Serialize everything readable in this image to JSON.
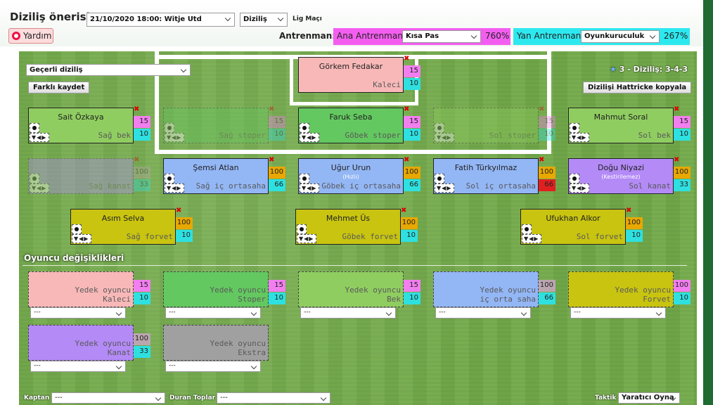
{
  "title": "Diziliş önerisi",
  "match_select": "21/10/2020 18:00: Witje Utd",
  "view_select": "Diziliş",
  "match_type": "Lig Maçı",
  "help_label": "Yardım",
  "training": {
    "label": "Antrenman:",
    "main_label": "Ana Antrenman",
    "main_value": "Kısa Pas",
    "main_pct": "760%",
    "side_label": "Yan Antrenman",
    "side_value": "Oyunkuruculuk",
    "side_pct": "267%"
  },
  "lineup_select": "Geçerli diziliş",
  "save_as_label": "Farklı kaydet",
  "copy_label": "Dizilişi Hattricke kopyala",
  "formation_label": "3 - Diziliş: 3-4-3",
  "players": {
    "gk": {
      "name": "Görkem Fedakar",
      "pos": "Kaleci",
      "s1": "15",
      "s2": "10"
    },
    "rb": {
      "name": "Sait Özkaya",
      "pos": "Sağ bek",
      "s1": "15",
      "s2": "10"
    },
    "rcd": {
      "name": "",
      "pos": "Sağ stoper",
      "s1": "15",
      "s2": "10"
    },
    "cd": {
      "name": "Faruk Seba",
      "pos": "Göbek stoper",
      "s1": "15",
      "s2": "10"
    },
    "lcd": {
      "name": "",
      "pos": "Sol stoper",
      "s1": "15",
      "s2": "10"
    },
    "lb": {
      "name": "Mahmut Soral",
      "pos": "Sol bek",
      "s1": "15",
      "s2": "10"
    },
    "rw": {
      "name": "",
      "pos": "Sağ kanat",
      "s1": "100",
      "s2": "33"
    },
    "rim": {
      "name": "Şemsi Atlan",
      "pos": "Sağ iç ortasaha",
      "s1": "100",
      "s2": "66"
    },
    "cim": {
      "name": "Uğur Urun",
      "sub": "(Hızlı)",
      "pos": "Göbek iç ortasaha",
      "s1": "100",
      "s2": "66"
    },
    "lim": {
      "name": "Fatih Türkyılmaz",
      "pos": "Sol iç ortasaha",
      "s1": "100",
      "s2": "66"
    },
    "lw": {
      "name": "Doğu Niyazi",
      "sub": "(Kestirilemez)",
      "pos": "Sol kanat",
      "s1": "100",
      "s2": "33"
    },
    "rf": {
      "name": "Asım Selva",
      "pos": "Sağ forvet",
      "s1": "100",
      "s2": "10"
    },
    "cf": {
      "name": "Mehmet Üs",
      "pos": "Göbek forvet",
      "s1": "100",
      "s2": "10"
    },
    "lf": {
      "name": "Ufukhan Alkor",
      "pos": "Sol forvet",
      "s1": "100",
      "s2": "10"
    }
  },
  "subs_title": "Oyuncu değişiklikleri",
  "subs": [
    {
      "label": "Yedek oyuncu",
      "pos": "Kaleci",
      "s1": "15",
      "s2": "10",
      "select": "---"
    },
    {
      "label": "Yedek oyuncu",
      "pos": "Stoper",
      "s1": "15",
      "s2": "10",
      "select": "---"
    },
    {
      "label": "Yedek oyuncu",
      "pos": "Bek",
      "s1": "15",
      "s2": "10",
      "select": "---"
    },
    {
      "label": "Yedek oyuncu",
      "pos": "iç orta saha",
      "s1": "100",
      "s2": "66",
      "select": "---"
    },
    {
      "label": "Yedek oyuncu",
      "pos": "Forvet",
      "s1": "100",
      "s2": "10",
      "select": "---"
    },
    {
      "label": "Yedek oyuncu",
      "pos": "Kanat",
      "s1": "100",
      "s2": "33",
      "select": "---"
    },
    {
      "label": "Yedek oyuncu",
      "pos": "Ekstra",
      "s1": "",
      "s2": "",
      "select": "---"
    }
  ],
  "footer": {
    "captain_label": "Kaptan",
    "captain_value": "---",
    "setpieces_label": "Duran Toplar",
    "setpieces_value": "---",
    "tactic_label": "Taktik",
    "tactic_value": "Yaratıcı Oyna"
  },
  "colors": {
    "gk": "#f8b8b8",
    "def": "#63c860",
    "back": "#8fcd60",
    "mid": "#93b6f5",
    "wing": "#b38af6",
    "fwd": "#c8c410",
    "extra": "#a0a0a0",
    "pink": "#f27ef0",
    "cyan": "#2ee0e0",
    "red": "#e02020",
    "orange": "#e8a800",
    "grey": "#bba6b0"
  }
}
